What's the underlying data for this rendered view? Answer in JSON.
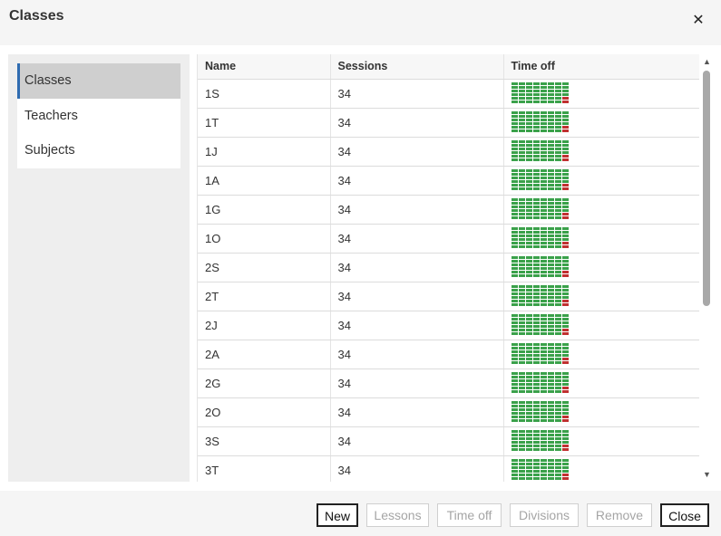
{
  "dialog": {
    "title": "Classes",
    "close_icon": "close-icon"
  },
  "sidebar": {
    "items": [
      {
        "label": "Classes",
        "active": true
      },
      {
        "label": "Teachers",
        "active": false
      },
      {
        "label": "Subjects",
        "active": false
      }
    ]
  },
  "table": {
    "columns": [
      "Name",
      "Sessions",
      "Time off"
    ],
    "rows": [
      {
        "name": "1S",
        "sessions": "34"
      },
      {
        "name": "1T",
        "sessions": "34"
      },
      {
        "name": "1J",
        "sessions": "34"
      },
      {
        "name": "1A",
        "sessions": "34"
      },
      {
        "name": "1G",
        "sessions": "34"
      },
      {
        "name": "1O",
        "sessions": "34"
      },
      {
        "name": "2S",
        "sessions": "34"
      },
      {
        "name": "2T",
        "sessions": "34"
      },
      {
        "name": "2J",
        "sessions": "34"
      },
      {
        "name": "2A",
        "sessions": "34"
      },
      {
        "name": "2G",
        "sessions": "34"
      },
      {
        "name": "2O",
        "sessions": "34"
      },
      {
        "name": "3S",
        "sessions": "34"
      },
      {
        "name": "3T",
        "sessions": "34"
      }
    ],
    "timeoff_grid": {
      "available_color": "#3aa14a",
      "off_color": "#c03030"
    }
  },
  "footer": {
    "buttons": [
      {
        "label": "New",
        "enabled": true
      },
      {
        "label": "Lessons",
        "enabled": false
      },
      {
        "label": "Time off",
        "enabled": false
      },
      {
        "label": "Divisions",
        "enabled": false
      },
      {
        "label": "Remove",
        "enabled": false
      },
      {
        "label": "Close",
        "enabled": true
      }
    ]
  },
  "colors": {
    "accent": "#2f6cb1",
    "active_item_bg": "#cfcfcf"
  }
}
